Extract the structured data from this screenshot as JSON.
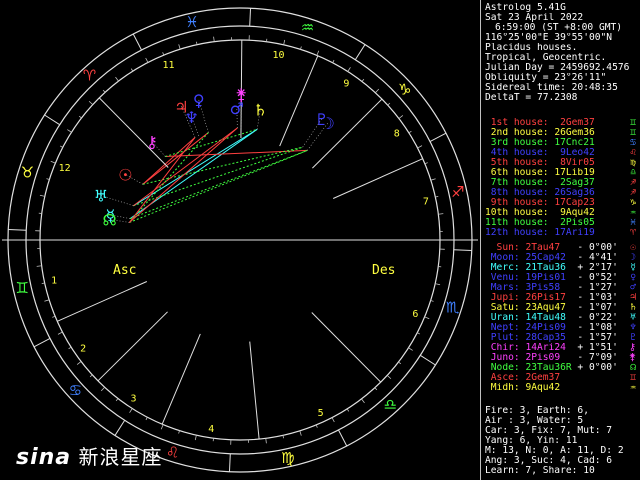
{
  "header": {
    "app": "Astrolog 5.41G",
    "date": "Sat 23 April 2022",
    "time": "6:59:00 (ST +8:00 GMT)",
    "location": "116°25'00\"E 39°55'00\"N",
    "house_system": "Placidus houses.",
    "zodiac": "Tropical, Geocentric.",
    "julian": "Julian Day = 2459692.4576",
    "obliquity": "Obliquity = 23°26'11\"",
    "sidereal": "Sidereal time: 20:48:35",
    "deltat": "DeltaT = 77.2308"
  },
  "houses": [
    {
      "label": "1st house:",
      "pos": "2Gem37",
      "color": "#ff4040",
      "glyph": "♊",
      "glyph_color": "#40ff40"
    },
    {
      "label": "2nd house:",
      "pos": "26Gem36",
      "color": "#ffff40",
      "glyph": "♊",
      "glyph_color": "#40ff40"
    },
    {
      "label": "3rd house:",
      "pos": "17Cnc21",
      "color": "#40ff40",
      "glyph": "♋",
      "glyph_color": "#4080ff"
    },
    {
      "label": "4th house:",
      "pos": "9Leo42",
      "color": "#4040ff",
      "glyph": "♌",
      "glyph_color": "#ff4040"
    },
    {
      "label": "5th house:",
      "pos": "8Vir05",
      "color": "#ff4040",
      "glyph": "♍",
      "glyph_color": "#ffff40"
    },
    {
      "label": "6th house:",
      "pos": "17Lib19",
      "color": "#ffff40",
      "glyph": "♎",
      "glyph_color": "#40ff40"
    },
    {
      "label": "7th house:",
      "pos": "2Sag37",
      "color": "#40ff40",
      "glyph": "♐",
      "glyph_color": "#ff4040"
    },
    {
      "label": "8th house:",
      "pos": "26Sag36",
      "color": "#4040ff",
      "glyph": "♐",
      "glyph_color": "#ff4040"
    },
    {
      "label": "9th house:",
      "pos": "17Cap23",
      "color": "#ff4040",
      "glyph": "♑",
      "glyph_color": "#ffff40"
    },
    {
      "label": "10th house:",
      "pos": "9Aqu42",
      "color": "#ffff40",
      "glyph": "♒",
      "glyph_color": "#40ff40"
    },
    {
      "label": "11th house:",
      "pos": "2Pis05",
      "color": "#40ff40",
      "glyph": "♓",
      "glyph_color": "#4080ff"
    },
    {
      "label": "12th house:",
      "pos": "17Ari19",
      "color": "#4040ff",
      "glyph": "♈",
      "glyph_color": "#ff4040"
    }
  ],
  "planets": [
    {
      "name": "Sun:",
      "pos": "2Tau47",
      "lat": "- 0°00'",
      "color": "#ff4040",
      "glyph": "☉"
    },
    {
      "name": "Moon:",
      "pos": "25Cap42",
      "lat": "- 4°41'",
      "color": "#4040ff",
      "glyph": "☽"
    },
    {
      "name": "Merc:",
      "pos": "21Tau36",
      "lat": "+ 2°17'",
      "color": "#40ffff",
      "glyph": "☿"
    },
    {
      "name": "Venu:",
      "pos": "19Pis01",
      "lat": "- 0°52'",
      "color": "#4040ff",
      "glyph": "♀"
    },
    {
      "name": "Mars:",
      "pos": "3Pis58",
      "lat": "- 1°27'",
      "color": "#4040ff",
      "glyph": "♂"
    },
    {
      "name": "Jupi:",
      "pos": "26Pis17",
      "lat": "- 1°03'",
      "color": "#ff4040",
      "glyph": "♃"
    },
    {
      "name": "Satu:",
      "pos": "23Aqu47",
      "lat": "- 1°07'",
      "color": "#ffff40",
      "glyph": "♄"
    },
    {
      "name": "Uran:",
      "pos": "14Tau48",
      "lat": "- 0°22'",
      "color": "#40ffff",
      "glyph": "♅"
    },
    {
      "name": "Nept:",
      "pos": "24Pis09",
      "lat": "- 1°08'",
      "color": "#4040ff",
      "glyph": "♆"
    },
    {
      "name": "Plut:",
      "pos": "28Cap35",
      "lat": "- 1°57'",
      "color": "#4040ff",
      "glyph": "♇"
    },
    {
      "name": "Chir:",
      "pos": "14Ari24",
      "lat": "+ 1°51'",
      "color": "#ff40ff",
      "glyph": "⚷"
    },
    {
      "name": "Juno:",
      "pos": "2Pis09",
      "lat": "- 7°09'",
      "color": "#ff40ff",
      "glyph": "⚵"
    },
    {
      "name": "Node:",
      "pos": "23Tau36R",
      "lat": "+ 0°00'",
      "color": "#40ff40",
      "glyph": "☊"
    },
    {
      "name": "Asce:",
      "pos": "2Gem37",
      "lat": "",
      "color": "#ff4040",
      "glyph": "♊"
    },
    {
      "name": "Midh:",
      "pos": "9Aqu42",
      "lat": "",
      "color": "#ffff40",
      "glyph": "♒"
    }
  ],
  "summary": [
    "Fire: 3, Earth: 6,",
    "Air : 3, Water: 5",
    "Car: 3, Fix: 7, Mut: 7",
    "Yang: 6, Yin: 11",
    "M: 13, N: 0, A: 11, D: 2",
    "Ang: 3, Suc: 4, Cad: 6",
    "Learn: 7, Share: 10"
  ],
  "wheel": {
    "asc_label": "Asc",
    "desc_label": "Des",
    "house_numbers": [
      "1",
      "2",
      "3",
      "4",
      "5",
      "6",
      "7",
      "8",
      "9",
      "10",
      "11",
      "12"
    ],
    "sign_glyphs": [
      "♈",
      "♉",
      "♊",
      "♋",
      "♌",
      "♍",
      "♎",
      "♏",
      "♐",
      "♑",
      "♒",
      "♓"
    ],
    "sign_colors": [
      "#ff4040",
      "#ffff40",
      "#40ff40",
      "#4080ff",
      "#ff4040",
      "#ffff40",
      "#40ff40",
      "#4080ff",
      "#ff4040",
      "#ffff40",
      "#40ff40",
      "#4080ff"
    ],
    "asc_longitude": 62.6
  },
  "watermark": {
    "logo": "sina",
    "text": "新浪星座"
  }
}
